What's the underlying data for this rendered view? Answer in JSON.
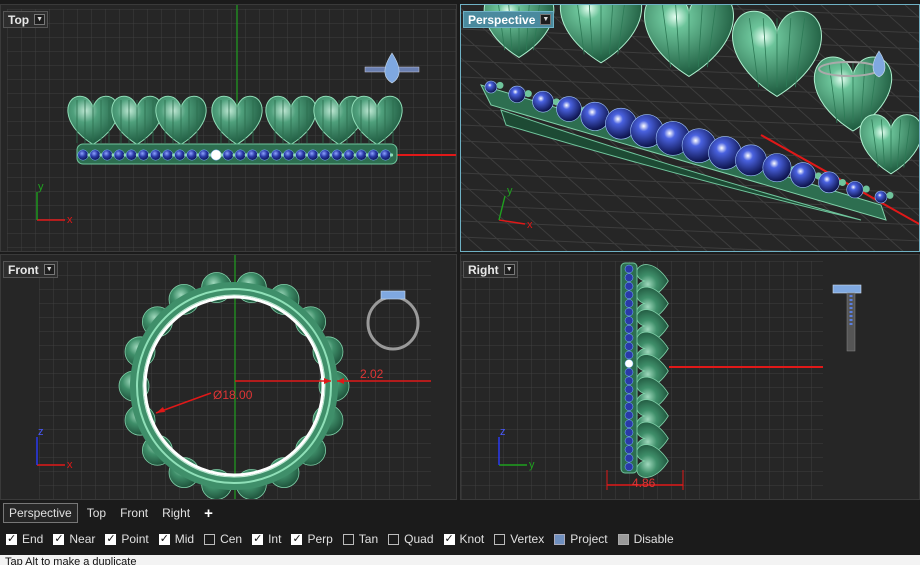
{
  "viewports": {
    "top": {
      "label": "Top"
    },
    "perspective": {
      "label": "Perspective"
    },
    "front": {
      "label": "Front",
      "dim_diameter": "Ø18.00",
      "dim_thickness": "2.02"
    },
    "right": {
      "label": "Right",
      "dim_width": "4.86"
    }
  },
  "axes": {
    "x": "x",
    "y": "y",
    "z": "z"
  },
  "tabs": {
    "items": [
      {
        "label": "Perspective",
        "active": true
      },
      {
        "label": "Top"
      },
      {
        "label": "Front"
      },
      {
        "label": "Right"
      }
    ],
    "add_label": "+"
  },
  "osnaps": [
    {
      "label": "End",
      "state": "on"
    },
    {
      "label": "Near",
      "state": "on"
    },
    {
      "label": "Point",
      "state": "on"
    },
    {
      "label": "Mid",
      "state": "on"
    },
    {
      "label": "Cen",
      "state": "off"
    },
    {
      "label": "Int",
      "state": "on"
    },
    {
      "label": "Perp",
      "state": "on"
    },
    {
      "label": "Tan",
      "state": "off"
    },
    {
      "label": "Quad",
      "state": "off"
    },
    {
      "label": "Knot",
      "state": "on"
    },
    {
      "label": "Vertex",
      "state": "off"
    },
    {
      "label": "Project",
      "state": "blue"
    },
    {
      "label": "Disable",
      "state": "grey"
    }
  ],
  "command_prompt": "Tap Alt to make a duplicate",
  "colors": {
    "viewport_bg": "#262626",
    "grid": "#3f3f3f",
    "axis_x": "#e01818",
    "axis_y": "#1fa01f",
    "heart_green": "#3f8f6a",
    "gem_blue": "#1f2f8f",
    "active_label": "#4a8a9e"
  }
}
